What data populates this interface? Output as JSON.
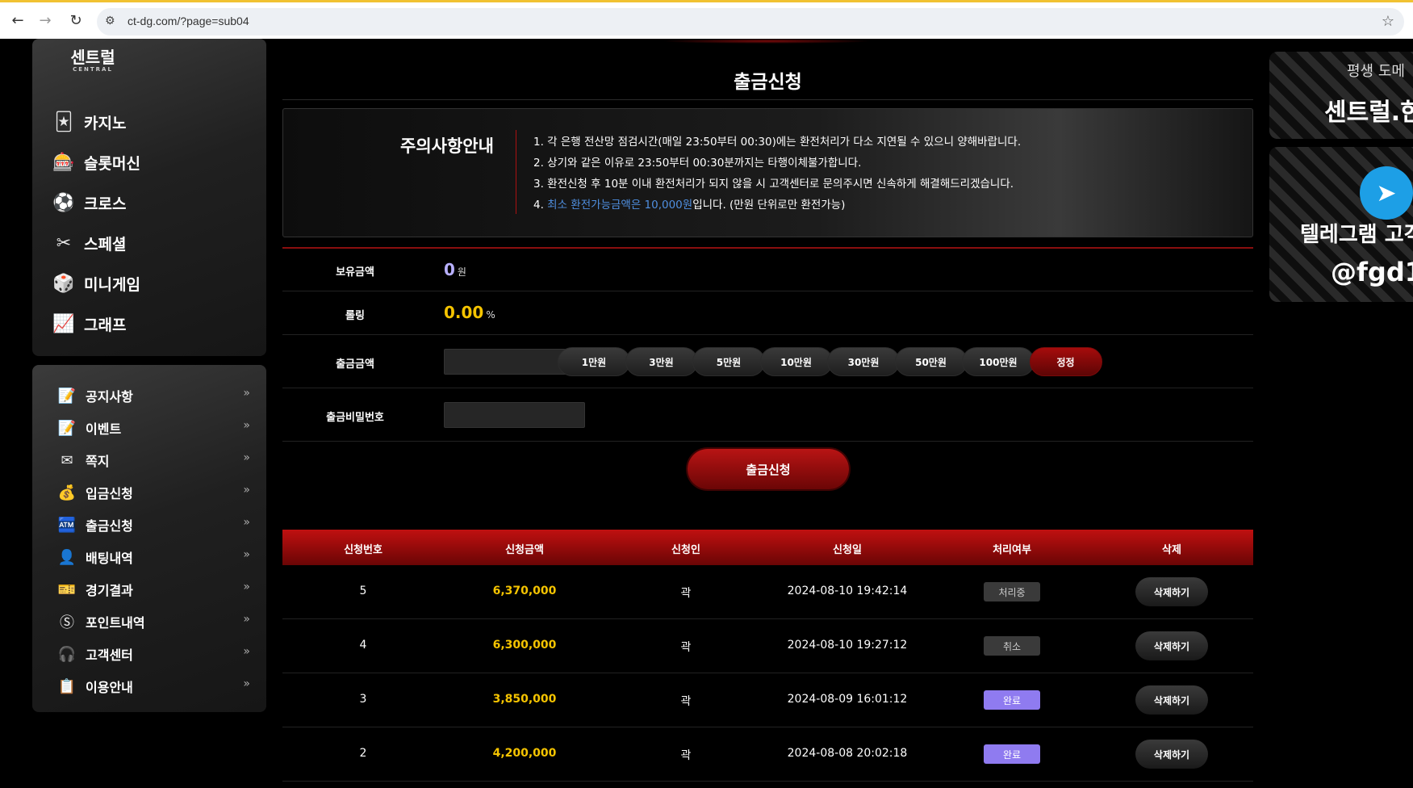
{
  "browser": {
    "url": "ct-dg.com/?page=sub04",
    "back_icon": "←",
    "forward_icon": "→",
    "reload_icon": "↻",
    "site_icon": "⚙",
    "star_icon": "☆"
  },
  "logo": {
    "text": "센트럴",
    "sub": "CENTRAL"
  },
  "game_menu": [
    {
      "label": "카지노",
      "icon": "🃏"
    },
    {
      "label": "슬롯머신",
      "icon": "🎰"
    },
    {
      "label": "크로스",
      "icon": "⚽"
    },
    {
      "label": "스페셜",
      "icon": "✂"
    },
    {
      "label": "미니게임",
      "icon": "🎲"
    },
    {
      "label": "그래프",
      "icon": "📈"
    }
  ],
  "sub_menu": [
    {
      "label": "공지사항",
      "icon": "📝"
    },
    {
      "label": "이벤트",
      "icon": "📝"
    },
    {
      "label": "쪽지",
      "icon": "✉"
    },
    {
      "label": "입금신청",
      "icon": "💰"
    },
    {
      "label": "출금신청",
      "icon": "🏧"
    },
    {
      "label": "배팅내역",
      "icon": "👤"
    },
    {
      "label": "경기결과",
      "icon": "🎫"
    },
    {
      "label": "포인트내역",
      "icon": "Ⓢ"
    },
    {
      "label": "고객센터",
      "icon": "🎧"
    },
    {
      "label": "이용안내",
      "icon": "📋"
    }
  ],
  "sub_menu_arrow": "»",
  "page": {
    "title": "출금신청",
    "notice_title": "주의사항안내",
    "notice": [
      {
        "text": "1. 각 은행 전산망 점검시간(매일 23:50부터 00:30)에는 환전처리가 다소 지연될 수 있으니 양해바랍니다."
      },
      {
        "text": "2. 상기와 같은 이유로 23:50부터 00:30분까지는 타행이체불가합니다."
      },
      {
        "text": "3. 환전신청 후 10분 이내 환전처리가 되지 않을 시 고객센터로 문의주시면 신속하게 해결해드리겠습니다."
      }
    ],
    "notice4_prefix": "4. ",
    "notice4_highlight": "최소 환전가능금액은 10,000원",
    "notice4_suffix": "입니다. (만원 단위로만 환전가능)"
  },
  "form": {
    "balance_label": "보유금액",
    "balance_value": "0",
    "balance_unit": "원",
    "rolling_label": "롤링",
    "rolling_value": "0.00",
    "rolling_unit": "%",
    "amount_label": "출금금액",
    "amount_value": "",
    "quick_buttons": [
      "1만원",
      "3만원",
      "5만원",
      "10만원",
      "30만원",
      "50만원",
      "100만원"
    ],
    "reset_button": "정정",
    "password_label": "출금비밀번호",
    "password_value": "",
    "submit": "출금신청"
  },
  "table": {
    "headers": [
      "신청번호",
      "신청금액",
      "신청인",
      "신청일",
      "처리여부",
      "삭제"
    ],
    "rows": [
      {
        "id": "5",
        "amount": "6,370,000",
        "user": "곽",
        "date": "2024-08-10 19:42:14",
        "status": "처리중",
        "status_type": "gray",
        "delete": "삭제하기"
      },
      {
        "id": "4",
        "amount": "6,300,000",
        "user": "곽",
        "date": "2024-08-10 19:27:12",
        "status": "취소",
        "status_type": "gray",
        "delete": "삭제하기"
      },
      {
        "id": "3",
        "amount": "3,850,000",
        "user": "곽",
        "date": "2024-08-09 16:01:12",
        "status": "완료",
        "status_type": "done",
        "delete": "삭제하기"
      },
      {
        "id": "2",
        "amount": "4,200,000",
        "user": "곽",
        "date": "2024-08-08 20:02:18",
        "status": "완료",
        "status_type": "done",
        "delete": "삭제하기"
      }
    ]
  },
  "banners": {
    "domain_top": "평생 도메",
    "domain_main": "센트럴.한",
    "telegram_line1": "텔레그램 고객",
    "telegram_line2": "@fgd1",
    "telegram_icon": "➤"
  },
  "colors": {
    "accent_red": "#b81414",
    "money_yellow": "#f5c400",
    "balance_purple": "#b8b0ff",
    "status_done": "#8f7bf0",
    "notice_highlight": "#4f8fe0"
  }
}
